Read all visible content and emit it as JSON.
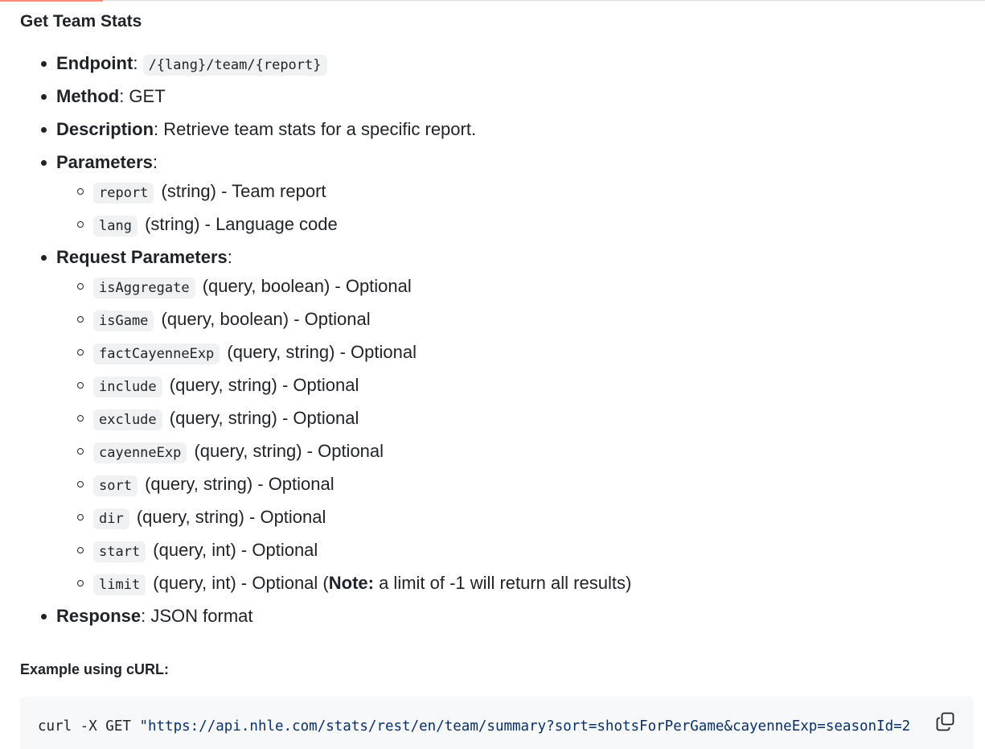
{
  "heading": "Get Team Stats",
  "endpoint": {
    "label": "Endpoint",
    "sep": ":",
    "value": "/{lang}/team/{report}"
  },
  "method": {
    "label": "Method",
    "rest": ": GET"
  },
  "description": {
    "label": "Description",
    "rest": ": Retrieve team stats for a specific report."
  },
  "parameters": {
    "label": "Parameters",
    "rest": ":",
    "items": [
      {
        "code": "report",
        "text": " (string) - Team report"
      },
      {
        "code": "lang",
        "text": " (string) - Language code"
      }
    ]
  },
  "request_parameters": {
    "label": "Request Parameters",
    "rest": ":",
    "items": [
      {
        "code": "isAggregate",
        "text": " (query, boolean) - Optional"
      },
      {
        "code": "isGame",
        "text": " (query, boolean) - Optional"
      },
      {
        "code": "factCayenneExp",
        "text": " (query, string) - Optional"
      },
      {
        "code": "include",
        "text": " (query, string) - Optional"
      },
      {
        "code": "exclude",
        "text": " (query, string) - Optional"
      },
      {
        "code": "cayenneExp",
        "text": " (query, string) - Optional"
      },
      {
        "code": "sort",
        "text": " (query, string) - Optional"
      },
      {
        "code": "dir",
        "text": " (query, string) - Optional"
      },
      {
        "code": "start",
        "text": " (query, int) - Optional"
      },
      {
        "code": "limit",
        "text": " (query, int) - Optional (",
        "note_label": "Note:",
        "note_text": " a limit of -1 will return all results)"
      }
    ]
  },
  "response": {
    "label": "Response",
    "rest": ": JSON format"
  },
  "example_label": "Example using cURL:",
  "code": {
    "prefix": "curl -X GET ",
    "string": "\"https://api.nhle.com/stats/rest/en/team/summary?sort=shotsForPerGame&cayenneExp=seasonId=2"
  },
  "copy_icon": "copy-icon"
}
